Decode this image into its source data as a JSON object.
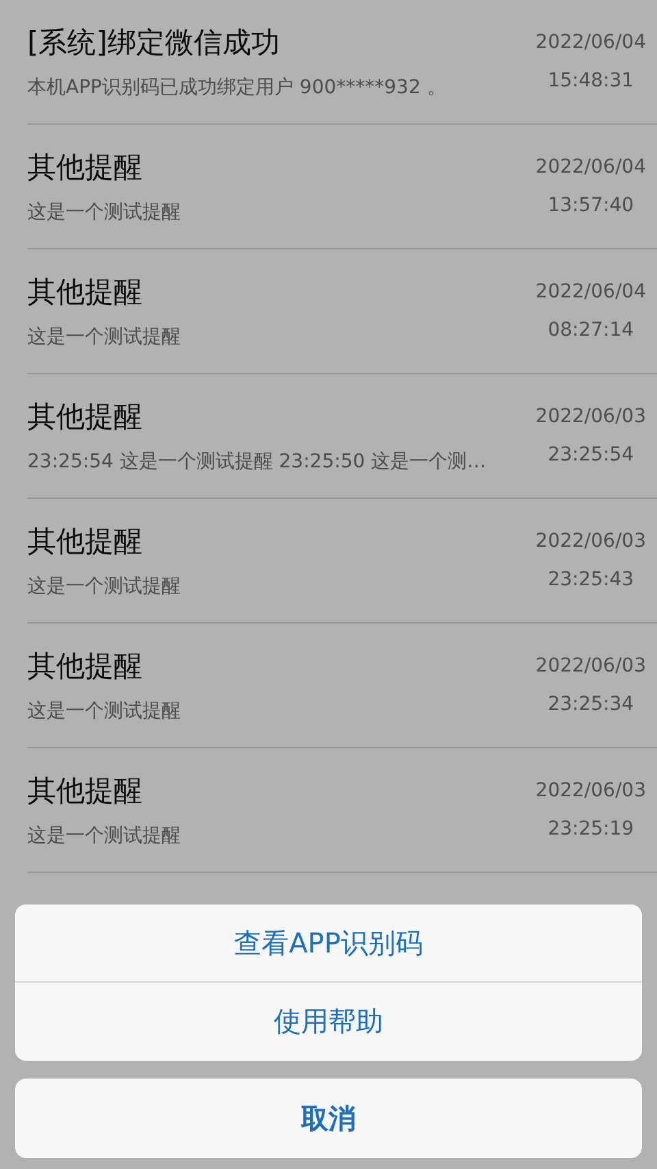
{
  "messages": [
    {
      "title": "[系统]绑定微信成功",
      "preview": "本机APP识别码已成功绑定用户 900*****932 。",
      "date": "2022/06/04",
      "time": "15:48:31"
    },
    {
      "title": "其他提醒",
      "preview": "这是一个测试提醒",
      "date": "2022/06/04",
      "time": "13:57:40"
    },
    {
      "title": "其他提醒",
      "preview": "这是一个测试提醒",
      "date": "2022/06/04",
      "time": "08:27:14"
    },
    {
      "title": "其他提醒",
      "preview": "23:25:54 这是一个测试提醒 23:25:50 这是一个测…",
      "date": "2022/06/03",
      "time": "23:25:54"
    },
    {
      "title": "其他提醒",
      "preview": "这是一个测试提醒",
      "date": "2022/06/03",
      "time": "23:25:43"
    },
    {
      "title": "其他提醒",
      "preview": "这是一个测试提醒",
      "date": "2022/06/03",
      "time": "23:25:34"
    },
    {
      "title": "其他提醒",
      "preview": "这是一个测试提醒",
      "date": "2022/06/03",
      "time": "23:25:19"
    }
  ],
  "action_sheet": {
    "actions": [
      "查看APP识别码",
      "使用帮助"
    ],
    "cancel": "取消"
  }
}
